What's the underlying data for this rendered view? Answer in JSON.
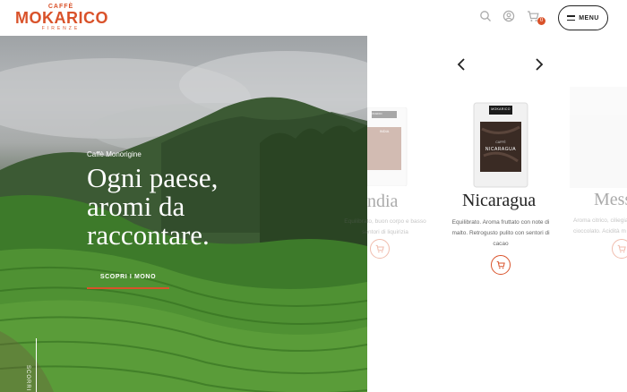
{
  "header": {
    "logo": {
      "top": "CAFFÈ",
      "main": "MOKARICO",
      "bottom": "FIRENZE"
    },
    "cart_count": "0",
    "menu_label": "MENU"
  },
  "hero": {
    "kicker": "Caffè Monorigine",
    "title_lines": [
      "Ogni paese,",
      "aromi da",
      "raccontare."
    ],
    "cta": "SCOPRI I MONO",
    "scroll_label": "SCORRI"
  },
  "carousel": {
    "products": [
      {
        "name": "India",
        "visible_name": "ndia",
        "desc_lines": [
          "Equilibrato, buon corpo e basso",
          "sentori di liquirizia"
        ],
        "bag_label": "INDIA",
        "bag_brand": "MOKARICO"
      },
      {
        "name": "Nicaragua",
        "desc_lines": [
          "Equilibrato. Aroma fruttato con note di",
          "malto. Retrogusto pulito con sentori di",
          "cacao"
        ],
        "bag_label": "NICARAGUA",
        "bag_brand": "MOKARICO",
        "bag_small": "CAFFÈ"
      },
      {
        "name": "Messico",
        "visible_name": "Mess",
        "desc_lines": [
          "Aroma citrico, ciliegia",
          "cioccolato. Acidità m"
        ]
      }
    ]
  },
  "colors": {
    "accent": "#d9522a",
    "text": "#222222"
  },
  "icons": [
    "search-icon",
    "user-icon",
    "cart-icon",
    "menu-icon",
    "chevron-left-icon",
    "chevron-right-icon"
  ]
}
